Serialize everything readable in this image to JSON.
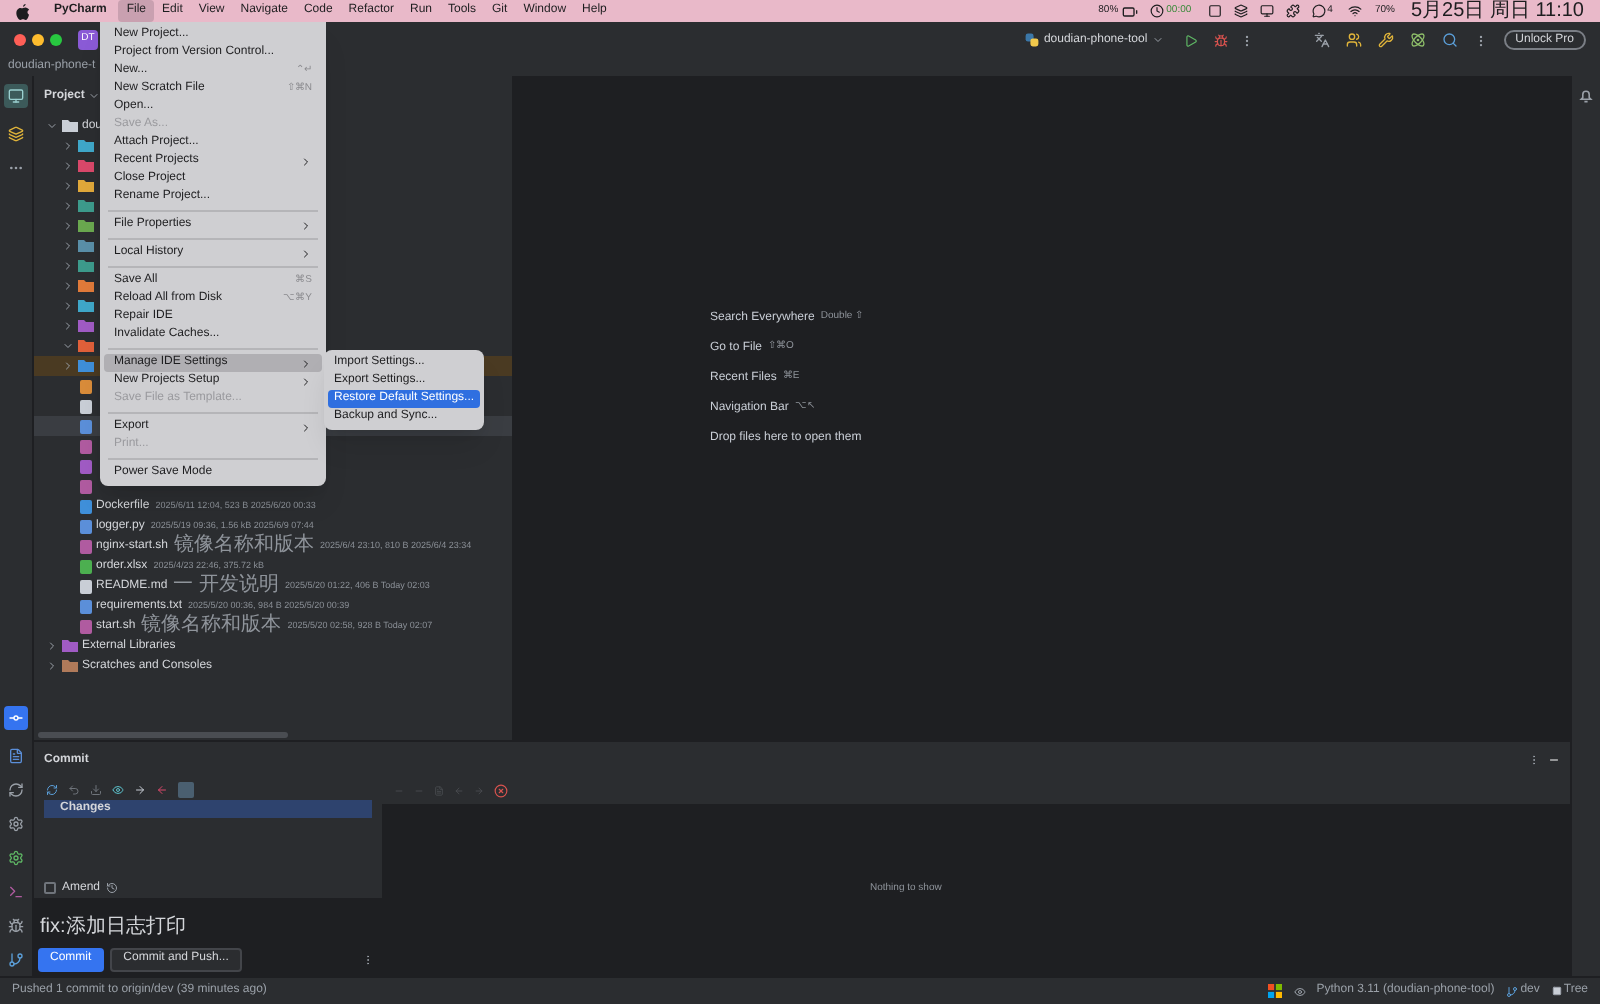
{
  "menubar": {
    "app": "PyCharm",
    "menus": [
      {
        "label": "File",
        "selected": true
      },
      {
        "label": "Edit",
        "selected": false
      },
      {
        "label": "View",
        "selected": false
      },
      {
        "label": "Navigate",
        "selected": false
      },
      {
        "label": "Code",
        "selected": false
      },
      {
        "label": "Refactor",
        "selected": false
      },
      {
        "label": "Run",
        "selected": false
      },
      {
        "label": "Tools",
        "selected": false
      },
      {
        "label": "Git",
        "selected": false
      },
      {
        "label": "Window",
        "selected": false
      },
      {
        "label": "Help",
        "selected": false
      }
    ],
    "status": {
      "battery": "80%",
      "timer": "00:00",
      "chat_count": "4",
      "usage": "70%",
      "clock": "5月25日 周日 11:10"
    }
  },
  "titlebar": {
    "badge": "DT",
    "run_config": "doudian-phone-tool",
    "unlock": "Unlock Pro"
  },
  "breadcrumb": "doudian-phone-t",
  "project_panel": {
    "title": "Project",
    "tree": [
      {
        "kind": "folder",
        "label": "dou",
        "expanded": true,
        "selected": false,
        "color": "#c9ced6",
        "children": [
          {
            "kind": "folder",
            "expanded": false,
            "selected": false,
            "color": "#3fa7c9"
          },
          {
            "kind": "folder",
            "expanded": false,
            "selected": false,
            "color": "#d9486a"
          },
          {
            "kind": "folder",
            "expanded": false,
            "selected": false,
            "color": "#e0a83a"
          },
          {
            "kind": "folder",
            "expanded": false,
            "selected": false,
            "color": "#3d9b8c"
          },
          {
            "kind": "folder",
            "expanded": false,
            "selected": false,
            "color": "#6aa84f"
          },
          {
            "kind": "folder",
            "expanded": false,
            "selected": false,
            "color": "#5a8fa8"
          },
          {
            "kind": "folder",
            "expanded": false,
            "selected": false,
            "color": "#3d9b8c"
          },
          {
            "kind": "folder",
            "expanded": false,
            "selected": false,
            "color": "#e07a3a"
          },
          {
            "kind": "folder",
            "expanded": false,
            "selected": false,
            "color": "#3fa7c9"
          },
          {
            "kind": "folder",
            "expanded": false,
            "selected": false,
            "color": "#a05bc4"
          },
          {
            "kind": "folder",
            "expanded": true,
            "selected": false,
            "color": "#e0603a"
          },
          {
            "kind": "folder",
            "expanded": false,
            "selected": false,
            "highlighted": true,
            "color": "#3f8fd9"
          },
          {
            "kind": "file",
            "selected": false,
            "color": "#d98c3a"
          },
          {
            "kind": "file",
            "selected": false,
            "color": "#c9ced6"
          },
          {
            "kind": "file",
            "selected": true,
            "color": "#5b8fd9"
          },
          {
            "kind": "file",
            "selected": false,
            "color": "#b05ba0"
          },
          {
            "kind": "file",
            "selected": false,
            "color": "#a05bc4"
          },
          {
            "kind": "file",
            "selected": false,
            "color": "#b05ba0"
          },
          {
            "kind": "file",
            "label": "Dockerfile",
            "meta": "2025/6/11 12:04, 523 B 2025/6/20 00:33",
            "selected": false,
            "color": "#3f8fd9"
          },
          {
            "kind": "file",
            "label": "logger.py",
            "meta": "2025/5/19 09:36, 1.56 kB 2025/6/9 07:44",
            "selected": false,
            "color": "#5b8fd9"
          },
          {
            "kind": "file",
            "label": "nginx-start.sh",
            "note": "镜像名称和版本",
            "meta": "2025/6/4 23:10, 810 B 2025/6/4 23:34",
            "selected": false,
            "color": "#b05ba0"
          },
          {
            "kind": "file",
            "label": "order.xlsx",
            "meta": "2025/4/23 22:46, 375.72 kB",
            "selected": false,
            "color": "#4caf50"
          },
          {
            "kind": "file",
            "label": "README.md",
            "note": "一 开发说明",
            "meta": "2025/5/20 01:22, 406 B Today 02:03",
            "selected": false,
            "color": "#c9ced6"
          },
          {
            "kind": "file",
            "label": "requirements.txt",
            "meta": "2025/5/20 00:36, 984 B 2025/5/20 00:39",
            "selected": false,
            "color": "#5b8fd9"
          },
          {
            "kind": "file",
            "label": "start.sh",
            "note": "镜像名称和版本",
            "meta": "2025/5/20 02:58, 928 B Today 02:07",
            "selected": false,
            "color": "#b05ba0"
          }
        ]
      },
      {
        "kind": "folder",
        "label": "External Libraries",
        "expanded": false,
        "selected": false,
        "color": "#a05bc4"
      },
      {
        "kind": "folder",
        "label": "Scratches and Consoles",
        "expanded": false,
        "selected": false,
        "color": "#b07a5a"
      }
    ]
  },
  "editor_hints": [
    {
      "label": "Search Everywhere",
      "shortcut": "Double ⇧"
    },
    {
      "label": "Go to File",
      "shortcut": "⇧⌘O"
    },
    {
      "label": "Recent Files",
      "shortcut": "⌘E"
    },
    {
      "label": "Navigation Bar",
      "shortcut": "⌥↖"
    },
    {
      "label": "Drop files here to open them"
    }
  ],
  "file_menu": [
    {
      "kind": "item",
      "label": "New Project...",
      "disabled": false,
      "submenu": false,
      "selected": false
    },
    {
      "kind": "item",
      "label": "Project from Version Control...",
      "disabled": false,
      "submenu": false,
      "selected": false
    },
    {
      "kind": "item",
      "label": "New...",
      "shortcut": "⌃↵",
      "disabled": false,
      "submenu": false,
      "selected": false
    },
    {
      "kind": "item",
      "label": "New Scratch File",
      "shortcut": "⇧⌘N",
      "disabled": false,
      "submenu": false,
      "selected": false
    },
    {
      "kind": "item",
      "label": "Open...",
      "disabled": false,
      "submenu": false,
      "selected": false
    },
    {
      "kind": "item",
      "label": "Save As...",
      "disabled": true,
      "submenu": false,
      "selected": false
    },
    {
      "kind": "item",
      "label": "Attach Project...",
      "disabled": false,
      "submenu": false,
      "selected": false
    },
    {
      "kind": "item",
      "label": "Recent Projects",
      "disabled": false,
      "submenu": true,
      "selected": false
    },
    {
      "kind": "item",
      "label": "Close Project",
      "disabled": false,
      "submenu": false,
      "selected": false
    },
    {
      "kind": "item",
      "label": "Rename Project...",
      "disabled": false,
      "submenu": false,
      "selected": false
    },
    {
      "kind": "separator"
    },
    {
      "kind": "item",
      "label": "File Properties",
      "disabled": false,
      "submenu": true,
      "selected": false
    },
    {
      "kind": "separator"
    },
    {
      "kind": "item",
      "label": "Local History",
      "disabled": false,
      "submenu": true,
      "selected": false
    },
    {
      "kind": "separator"
    },
    {
      "kind": "item",
      "label": "Save All",
      "shortcut": "⌘S",
      "disabled": false,
      "submenu": false,
      "selected": false
    },
    {
      "kind": "item",
      "label": "Reload All from Disk",
      "shortcut": "⌥⌘Y",
      "disabled": false,
      "submenu": false,
      "selected": false
    },
    {
      "kind": "item",
      "label": "Repair IDE",
      "disabled": false,
      "submenu": false,
      "selected": false
    },
    {
      "kind": "item",
      "label": "Invalidate Caches...",
      "disabled": false,
      "submenu": false,
      "selected": false
    },
    {
      "kind": "separator"
    },
    {
      "kind": "item",
      "label": "Manage IDE Settings",
      "disabled": false,
      "submenu": true,
      "selected": true
    },
    {
      "kind": "item",
      "label": "New Projects Setup",
      "disabled": false,
      "submenu": true,
      "selected": false
    },
    {
      "kind": "item",
      "label": "Save File as Template...",
      "disabled": true,
      "submenu": false,
      "selected": false
    },
    {
      "kind": "separator"
    },
    {
      "kind": "item",
      "label": "Export",
      "disabled": false,
      "submenu": true,
      "selected": false
    },
    {
      "kind": "item",
      "label": "Print...",
      "disabled": true,
      "submenu": false,
      "selected": false
    },
    {
      "kind": "separator"
    },
    {
      "kind": "item",
      "label": "Power Save Mode",
      "disabled": false,
      "submenu": false,
      "selected": false
    }
  ],
  "settings_submenu": [
    {
      "label": "Import Settings...",
      "selected": false
    },
    {
      "label": "Export Settings...",
      "selected": false
    },
    {
      "label": "Restore Default Settings...",
      "selected": true
    },
    {
      "label": "Backup and Sync...",
      "selected": false
    }
  ],
  "commit_panel": {
    "title": "Commit",
    "changes": {
      "label": "Changes",
      "selected": true
    },
    "amend": {
      "label": "Amend",
      "checked": false
    },
    "message": "fix:添加日志打印",
    "buttons": [
      {
        "label": "Commit",
        "primary": true
      },
      {
        "label": "Commit and Push...",
        "primary": false
      }
    ],
    "diff_empty": "Nothing to show"
  },
  "status_bar": {
    "message": "Pushed 1 commit to origin/dev (39 minutes ago)",
    "interpreter": "Python 3.11 (doudian-phone-tool)",
    "branch": "dev",
    "view": "Tree"
  }
}
